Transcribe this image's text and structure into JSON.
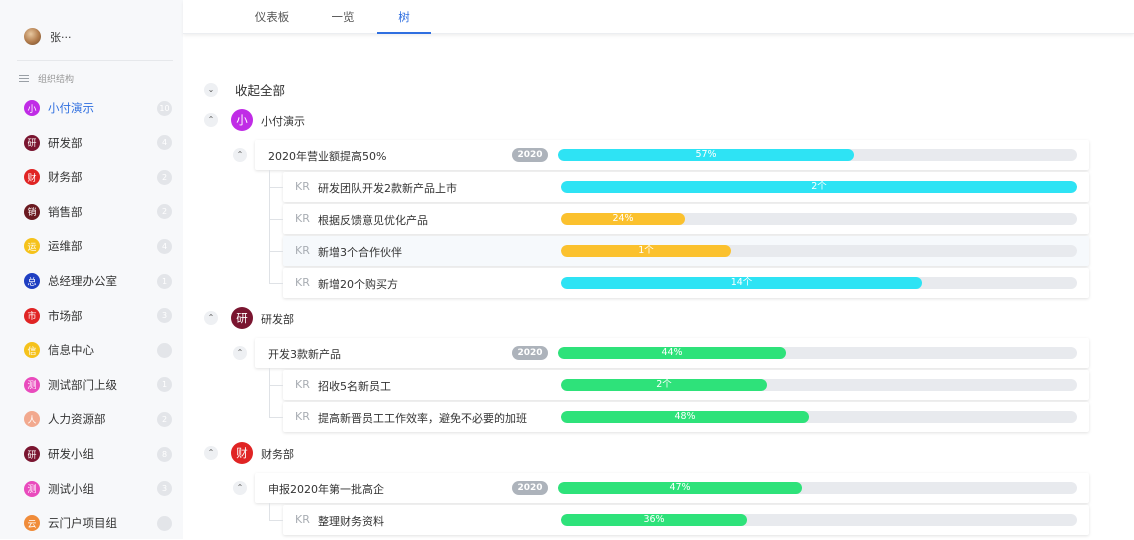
{
  "user": {
    "name": "张···"
  },
  "sidebar": {
    "section_title": "组织结构",
    "items": [
      {
        "badge": "小",
        "label": "小付演示",
        "count": "10",
        "color": "#c02ce6",
        "active": true
      },
      {
        "badge": "研",
        "label": "研发部",
        "count": "4",
        "color": "#7a1530"
      },
      {
        "badge": "财",
        "label": "财务部",
        "count": "2",
        "color": "#e02424"
      },
      {
        "badge": "销",
        "label": "销售部",
        "count": "2",
        "color": "#6b1a20"
      },
      {
        "badge": "运",
        "label": "运维部",
        "count": "4",
        "color": "#f5c21b"
      },
      {
        "badge": "总",
        "label": "总经理办公室",
        "count": "1",
        "color": "#1f3fc2"
      },
      {
        "badge": "市",
        "label": "市场部",
        "count": "3",
        "color": "#e02424"
      },
      {
        "badge": "信",
        "label": "信息中心",
        "count": "",
        "color": "#f5c21b"
      },
      {
        "badge": "测",
        "label": "测试部门上级",
        "count": "1",
        "color": "#e94bbd"
      },
      {
        "badge": "人",
        "label": "人力资源部",
        "count": "2",
        "color": "#f2a98e"
      },
      {
        "badge": "研",
        "label": "研发小组",
        "count": "8",
        "color": "#7a1530"
      },
      {
        "badge": "测",
        "label": "测试小组",
        "count": "3",
        "color": "#e94bbd"
      },
      {
        "badge": "云",
        "label": "云门户项目组",
        "count": "",
        "color": "#f08c3a"
      }
    ]
  },
  "tabs": [
    {
      "label": "仪表板"
    },
    {
      "label": "一览"
    },
    {
      "label": "树",
      "active": true
    }
  ],
  "tree": {
    "collapse_all_label": "收起全部",
    "departments": [
      {
        "badge": "小",
        "name": "小付演示",
        "color": "#c02ce6",
        "objectives": [
          {
            "title": "2020年营业额提高50%",
            "year": "2020",
            "progress_text": "57%",
            "progress": 0.57,
            "color": "#2ee3f4",
            "key_results": [
              {
                "tag": "KR",
                "title": "研发团队开发2款新产品上市",
                "progress_text": "2个",
                "progress": 1.0,
                "color": "#2ee3f4"
              },
              {
                "tag": "KR",
                "title": "根据反馈意见优化产品",
                "progress_text": "24%",
                "progress": 0.24,
                "color": "#fbc12e"
              },
              {
                "tag": "KR",
                "title": "新增3个合作伙伴",
                "progress_text": "1个",
                "progress": 0.33,
                "color": "#fbc12e"
              },
              {
                "tag": "KR",
                "title": "新增20个购买方",
                "progress_text": "14个",
                "progress": 0.7,
                "color": "#2ee3f4"
              }
            ]
          }
        ]
      },
      {
        "badge": "研",
        "name": "研发部",
        "color": "#7a1530",
        "objectives": [
          {
            "title": "开发3款新产品",
            "year": "2020",
            "progress_text": "44%",
            "progress": 0.44,
            "color": "#2ee27a",
            "key_results": [
              {
                "tag": "KR",
                "title": "招收5名新员工",
                "progress_text": "2个",
                "progress": 0.4,
                "color": "#2ee27a"
              },
              {
                "tag": "KR",
                "title": "提高新晋员工工作效率，避免不必要的加班",
                "progress_text": "48%",
                "progress": 0.48,
                "color": "#2ee27a"
              }
            ]
          }
        ]
      },
      {
        "badge": "财",
        "name": "财务部",
        "color": "#e02424",
        "objectives": [
          {
            "title": "申报2020年第一批高企",
            "year": "2020",
            "progress_text": "47%",
            "progress": 0.47,
            "color": "#2ee27a",
            "key_results": [
              {
                "tag": "KR",
                "title": "整理财务资料",
                "progress_text": "36%",
                "progress": 0.36,
                "color": "#2ee27a"
              }
            ]
          }
        ]
      }
    ]
  }
}
